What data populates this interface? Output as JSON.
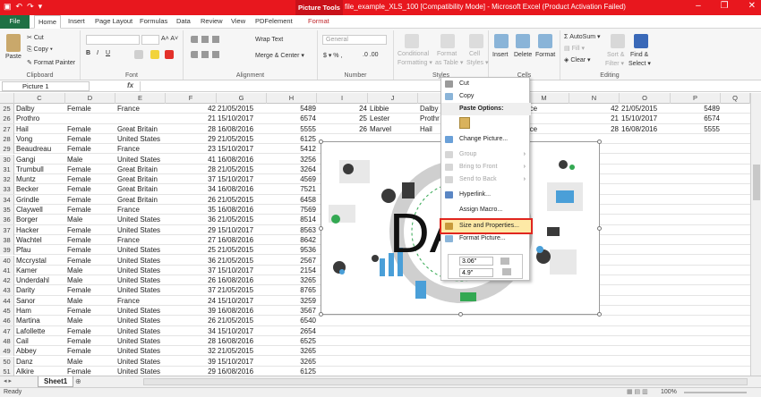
{
  "titlebar": {
    "qat": [
      "▣",
      "↶",
      "↷",
      "▾"
    ],
    "picture_tools": "Picture Tools",
    "title": "file_example_XLS_100  [Compatibility Mode]  -  Microsoft Excel (Product Activation Failed)",
    "controls": [
      "–",
      "❐",
      "✕"
    ]
  },
  "tabs": [
    "File",
    "Home",
    "Insert",
    "Page Layout",
    "Formulas",
    "Data",
    "Review",
    "View",
    "PDFelement",
    "Format"
  ],
  "ribbon": {
    "clipboard": {
      "paste": "Paste",
      "cut": "Cut",
      "copy": "Copy ▾",
      "format_painter": "Format Painter",
      "label": "Clipboard"
    },
    "font": {
      "label": "Font",
      "font_size_arrows": "A˄ A˅"
    },
    "alignment": {
      "wrap": "Wrap Text",
      "merge": "Merge & Center ▾",
      "label": "Alignment"
    },
    "number": {
      "format": "General",
      "currency": "$ ▾  %  ,",
      "decimals": ".0  .00",
      "label": "Number"
    },
    "styles": {
      "conditional": "Conditional",
      "conditional2": "Formatting ▾",
      "format_table": "Format",
      "format_table2": "as Table ▾",
      "cell_styles": "Cell",
      "cell_styles2": "Styles ▾",
      "label": "Styles"
    },
    "cells": {
      "insert": "Insert",
      "delete": "Delete",
      "format": "Format",
      "label": "Cells"
    },
    "editing": {
      "autosum": "AutoSum ▾",
      "fill": "Fill ▾",
      "clear": "Clear ▾",
      "sort": "Sort &",
      "sort2": "Filter ▾",
      "find": "Find &",
      "find2": "Select ▾",
      "label": "Editing"
    }
  },
  "formula_bar": {
    "name_box": "Picture 1",
    "fx": "fx",
    "value": ""
  },
  "columns": [
    "C",
    "D",
    "E",
    "F",
    "G",
    "H",
    "I",
    "J",
    "K",
    "L",
    "M",
    "N",
    "O",
    "P",
    "Q"
  ],
  "rows": [
    {
      "n": "25",
      "c": "Dalby",
      "d": "Female",
      "e": "France",
      "f": "42",
      "g": "21/05/2015",
      "h": "5489"
    },
    {
      "n": "26",
      "c": "Prothro",
      "d": "",
      "e": "",
      "f": "21",
      "g": "15/10/2017",
      "h": "6574"
    },
    {
      "n": "27",
      "c": "Hail",
      "d": "Female",
      "e": "Great Britain",
      "f": "28",
      "g": "16/08/2016",
      "h": "5555"
    },
    {
      "n": "28",
      "c": "Vong",
      "d": "Female",
      "e": "United States",
      "f": "29",
      "g": "21/05/2015",
      "h": "6125"
    },
    {
      "n": "29",
      "c": "Beaudreau",
      "d": "Female",
      "e": "France",
      "f": "23",
      "g": "15/10/2017",
      "h": "5412"
    },
    {
      "n": "30",
      "c": "Gangi",
      "d": "Male",
      "e": "United States",
      "f": "41",
      "g": "16/08/2016",
      "h": "3256"
    },
    {
      "n": "31",
      "c": "Trumbull",
      "d": "Female",
      "e": "Great Britain",
      "f": "28",
      "g": "21/05/2015",
      "h": "3264"
    },
    {
      "n": "32",
      "c": "Muntz",
      "d": "Female",
      "e": "Great Britain",
      "f": "37",
      "g": "15/10/2017",
      "h": "4569"
    },
    {
      "n": "33",
      "c": "Becker",
      "d": "Female",
      "e": "Great Britain",
      "f": "34",
      "g": "16/08/2016",
      "h": "7521"
    },
    {
      "n": "34",
      "c": "Grindle",
      "d": "Female",
      "e": "Great Britain",
      "f": "26",
      "g": "21/05/2015",
      "h": "6458"
    },
    {
      "n": "35",
      "c": "Claywell",
      "d": "Female",
      "e": "France",
      "f": "35",
      "g": "16/08/2016",
      "h": "7569"
    },
    {
      "n": "36",
      "c": "Borger",
      "d": "Male",
      "e": "United States",
      "f": "36",
      "g": "21/05/2015",
      "h": "8514"
    },
    {
      "n": "37",
      "c": "Hacker",
      "d": "Female",
      "e": "United States",
      "f": "29",
      "g": "15/10/2017",
      "h": "8563"
    },
    {
      "n": "38",
      "c": "Wachtel",
      "d": "Female",
      "e": "France",
      "f": "27",
      "g": "16/08/2016",
      "h": "8642"
    },
    {
      "n": "39",
      "c": "Pfau",
      "d": "Female",
      "e": "United States",
      "f": "25",
      "g": "21/05/2015",
      "h": "9536"
    },
    {
      "n": "40",
      "c": "Mccrystal",
      "d": "Female",
      "e": "United States",
      "f": "36",
      "g": "21/05/2015",
      "h": "2567"
    },
    {
      "n": "41",
      "c": "Kamer",
      "d": "Male",
      "e": "United States",
      "f": "37",
      "g": "15/10/2017",
      "h": "2154"
    },
    {
      "n": "42",
      "c": "Underdahl",
      "d": "Male",
      "e": "United States",
      "f": "26",
      "g": "16/08/2016",
      "h": "3265"
    },
    {
      "n": "43",
      "c": "Darity",
      "d": "Female",
      "e": "United States",
      "f": "37",
      "g": "21/05/2015",
      "h": "8765"
    },
    {
      "n": "44",
      "c": "Sanor",
      "d": "Male",
      "e": "France",
      "f": "24",
      "g": "15/10/2017",
      "h": "3259"
    },
    {
      "n": "45",
      "c": "Ham",
      "d": "Female",
      "e": "United States",
      "f": "39",
      "g": "16/08/2016",
      "h": "3567"
    },
    {
      "n": "46",
      "c": "Martina",
      "d": "Male",
      "e": "United States",
      "f": "26",
      "g": "21/05/2015",
      "h": "6540"
    },
    {
      "n": "47",
      "c": "Lafollette",
      "d": "Female",
      "e": "United States",
      "f": "34",
      "g": "15/10/2017",
      "h": "2654"
    },
    {
      "n": "48",
      "c": "Cail",
      "d": "Female",
      "e": "United States",
      "f": "28",
      "g": "16/08/2016",
      "h": "6525"
    },
    {
      "n": "49",
      "c": "Abbey",
      "d": "Female",
      "e": "United States",
      "f": "32",
      "g": "21/05/2015",
      "h": "3265"
    },
    {
      "n": "50",
      "c": "Danz",
      "d": "Male",
      "e": "United States",
      "f": "39",
      "g": "15/10/2017",
      "h": "3265"
    },
    {
      "n": "51",
      "c": "Alkire",
      "d": "Female",
      "e": "United States",
      "f": "29",
      "g": "16/08/2016",
      "h": "6125"
    },
    {
      "n": "52",
      "c": "Alcrai",
      "d": "Female",
      "e": "United States",
      "f": "32",
      "g": "15/10/2017",
      "h": "1582"
    }
  ],
  "right_rows": [
    {
      "i": "24",
      "j": "Libbie",
      "k": "Dalby",
      "m": "rance",
      "o": "42",
      "p": "21/05/2015",
      "q": "5489"
    },
    {
      "i": "25",
      "j": "Lester",
      "k": "Prothr",
      "m": "",
      "o": "21",
      "p": "15/10/2017",
      "q": "6574"
    },
    {
      "i": "26",
      "j": "Marvel",
      "k": "Hail",
      "m": "rance",
      "o": "28",
      "p": "16/08/2016",
      "q": "5555"
    }
  ],
  "picture": {
    "text": "DATA"
  },
  "context_menu": {
    "items_top": [
      {
        "label": "Cut",
        "icon": "scissors-icon"
      },
      {
        "label": "Copy",
        "icon": "copy-icon"
      }
    ],
    "paste_header": "Paste Options:",
    "items": [
      {
        "label": "Change Picture...",
        "disabled": false,
        "sub": false
      },
      {
        "label": "Group",
        "disabled": true,
        "sub": true
      },
      {
        "label": "Bring to Front",
        "disabled": true,
        "sub": true
      },
      {
        "label": "Send to Back",
        "disabled": true,
        "sub": true
      },
      {
        "label": "Hyperlink...",
        "disabled": false,
        "sub": false
      },
      {
        "label": "Assign Macro...",
        "disabled": false,
        "sub": false
      },
      {
        "label": "Size and Properties...",
        "disabled": false,
        "sub": false,
        "highlight": true
      },
      {
        "label": "Format Picture...",
        "disabled": false,
        "sub": false
      }
    ]
  },
  "mini_toolbar": {
    "height": "3.06\"",
    "width": "4.9\""
  },
  "sheet_tabs": [
    "Sheet1"
  ],
  "status": {
    "mode": "Ready",
    "zoom": "100%"
  },
  "colors": {
    "titlebar": "#e8171e",
    "file_tab": "#1e7145",
    "highlight": "#e0261f"
  }
}
